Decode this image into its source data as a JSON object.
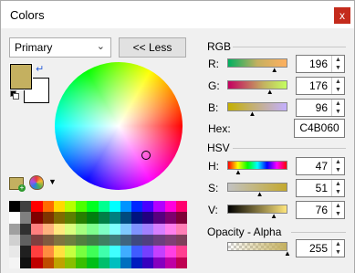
{
  "window": {
    "title": "Colors",
    "close_label": "x"
  },
  "mode": {
    "selected": "Primary"
  },
  "less_button": "<< Less",
  "primary_color": "#C4B060",
  "secondary_color": "#FFFFFF",
  "rgb": {
    "title": "RGB",
    "r_label": "R:",
    "r_value": "196",
    "g_label": "G:",
    "g_value": "176",
    "b_label": "B:",
    "b_value": "96",
    "hex_label": "Hex:",
    "hex_value": "C4B060"
  },
  "hsv": {
    "title": "HSV",
    "h_label": "H:",
    "h_value": "47",
    "s_label": "S:",
    "s_value": "51",
    "v_label": "V:",
    "v_value": "76"
  },
  "opacity": {
    "title": "Opacity - Alpha",
    "value": "255"
  },
  "palette_colors": [
    "#000000",
    "#404040",
    "#ff0000",
    "#ff6a00",
    "#ffd800",
    "#b6ff00",
    "#4cff00",
    "#00ff21",
    "#00ff90",
    "#00ffff",
    "#0094ff",
    "#0026ff",
    "#4800ff",
    "#b200ff",
    "#ff00dc",
    "#ff006e",
    "#ffffff",
    "#808080",
    "#7f0000",
    "#7f3300",
    "#7f6a00",
    "#5b7f00",
    "#267f00",
    "#007f0e",
    "#007f46",
    "#007f7f",
    "#004a7f",
    "#00137f",
    "#21007f",
    "#57007f",
    "#7f006e",
    "#7f0037",
    "#a0a0a0",
    "#303030",
    "#ff7f7f",
    "#ffb27f",
    "#ffe97f",
    "#daff7f",
    "#a5ff7f",
    "#7fff8e",
    "#7fffc5",
    "#7fffff",
    "#7fc9ff",
    "#7f92ff",
    "#a17fff",
    "#d67fff",
    "#ff7fed",
    "#ff7fb6",
    "#d0d0d0",
    "#606060",
    "#7f3f3f",
    "#7f593f",
    "#7f743f",
    "#6d7f3f",
    "#527f3f",
    "#3f7f47",
    "#3f7f62",
    "#3f7f7f",
    "#3f647f",
    "#3f497f",
    "#503f7f",
    "#6b3f7f",
    "#7f3f76",
    "#7f3f5b",
    "#e8e8e8",
    "#202020",
    "#ff3f3f",
    "#ff8c3f",
    "#ffe03f",
    "#c6ff3f",
    "#78ff3f",
    "#3fff57",
    "#3fffac",
    "#3fffff",
    "#3fadff",
    "#3f5cff",
    "#753fff",
    "#c43fff",
    "#ff3fe4",
    "#ff3f91",
    "#f4f4f4",
    "#101010",
    "#bf0000",
    "#bf4c00",
    "#bfa200",
    "#88bf00",
    "#39bf00",
    "#00bf18",
    "#00bf6c",
    "#00bfbf",
    "#006fbf",
    "#001cbf",
    "#3600bf",
    "#8500bf",
    "#bf00a5",
    "#bf0052"
  ],
  "levels": {
    "r": 0.77,
    "g": 0.69,
    "b": 0.38,
    "h": 0.13,
    "s": 0.51,
    "v": 0.76,
    "alpha": 1.0
  }
}
